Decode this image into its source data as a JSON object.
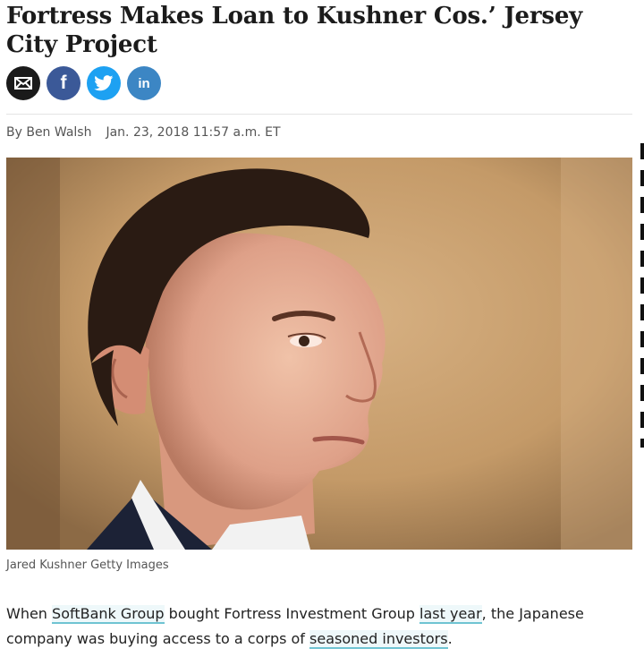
{
  "article": {
    "headline": "Fortress Makes Loan to Kushner Cos.’ Jersey City Project",
    "byline": "By Ben Walsh",
    "timestamp": "Jan. 23, 2018 11:57 a.m. ET",
    "caption": "Jared Kushner Getty Images",
    "paragraph": {
      "t1": "When ",
      "link1": "SoftBank Group",
      "t2": " bought Fortress Investment Group ",
      "link2": "last year",
      "t3": ", the Japanese company was buying access to a corps of ",
      "link3": "seasoned investors",
      "t4": "."
    }
  },
  "share": {
    "email_icon": "envelope-icon",
    "facebook_label": "f",
    "linkedin_label": "in"
  },
  "colors": {
    "facebook": "#3b5998",
    "twitter": "#1da1f2",
    "linkedin": "#3c86c4",
    "link_underline": "#6fc4d2"
  }
}
